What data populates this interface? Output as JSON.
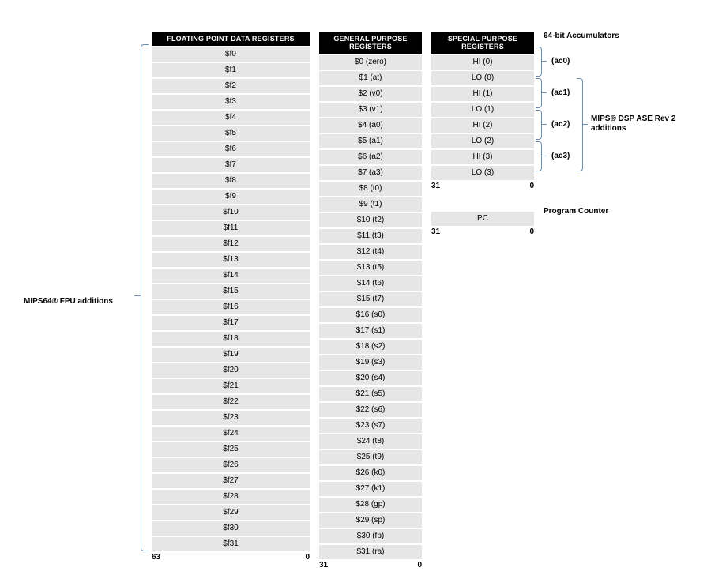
{
  "headers": {
    "fp": "FLOATING POINT DATA REGISTERS",
    "gp": "GENERAL PURPOSE REGISTERS",
    "sp": "SPECIAL PURPOSE REGISTERS"
  },
  "fp_regs": [
    "$f0",
    "$f1",
    "$f2",
    "$f3",
    "$f4",
    "$f5",
    "$f6",
    "$f7",
    "$f8",
    "$f9",
    "$f10",
    "$f11",
    "$f12",
    "$f13",
    "$f14",
    "$f15",
    "$f16",
    "$f17",
    "$f18",
    "$f19",
    "$f20",
    "$f21",
    "$f22",
    "$f23",
    "$f24",
    "$f25",
    "$f26",
    "$f27",
    "$f28",
    "$f29",
    "$f30",
    "$f31"
  ],
  "gp_regs": [
    "$0 (zero)",
    "$1 (at)",
    "$2 (v0)",
    "$3 (v1)",
    "$4 (a0)",
    "$5 (a1)",
    "$6 (a2)",
    "$7 (a3)",
    "$8 (t0)",
    "$9 (t1)",
    "$10 (t2)",
    "$11 (t3)",
    "$12 (t4)",
    "$13 (t5)",
    "$14 (t6)",
    "$15 (t7)",
    "$16 (s0)",
    "$17 (s1)",
    "$18 (s2)",
    "$19 (s3)",
    "$20 (s4)",
    "$21 (s5)",
    "$22 (s6)",
    "$23 (s7)",
    "$24 (t8)",
    "$25 (t9)",
    "$26 (k0)",
    "$27 (k1)",
    "$28 (gp)",
    "$29 (sp)",
    "$30 (fp)",
    "$31 (ra)"
  ],
  "sp_regs": [
    "HI (0)",
    "LO (0)",
    "HI (1)",
    "LO (1)",
    "HI (2)",
    "LO (2)",
    "HI (3)",
    "LO (3)"
  ],
  "pc_label": "PC",
  "bits": {
    "fp_hi": "63",
    "fp_lo": "0",
    "gp_hi": "31",
    "gp_lo": "0",
    "sp_hi": "31",
    "sp_lo": "0",
    "pc_hi": "31",
    "pc_lo": "0"
  },
  "labels": {
    "fpu": "MIPS64® FPU additions",
    "acc_title": "64-bit Accumulators",
    "accs": [
      "(ac0)",
      "(ac1)",
      "(ac2)",
      "(ac3)"
    ],
    "dsp": "MIPS® DSP ASE Rev 2 additions",
    "pc": "Program Counter"
  }
}
